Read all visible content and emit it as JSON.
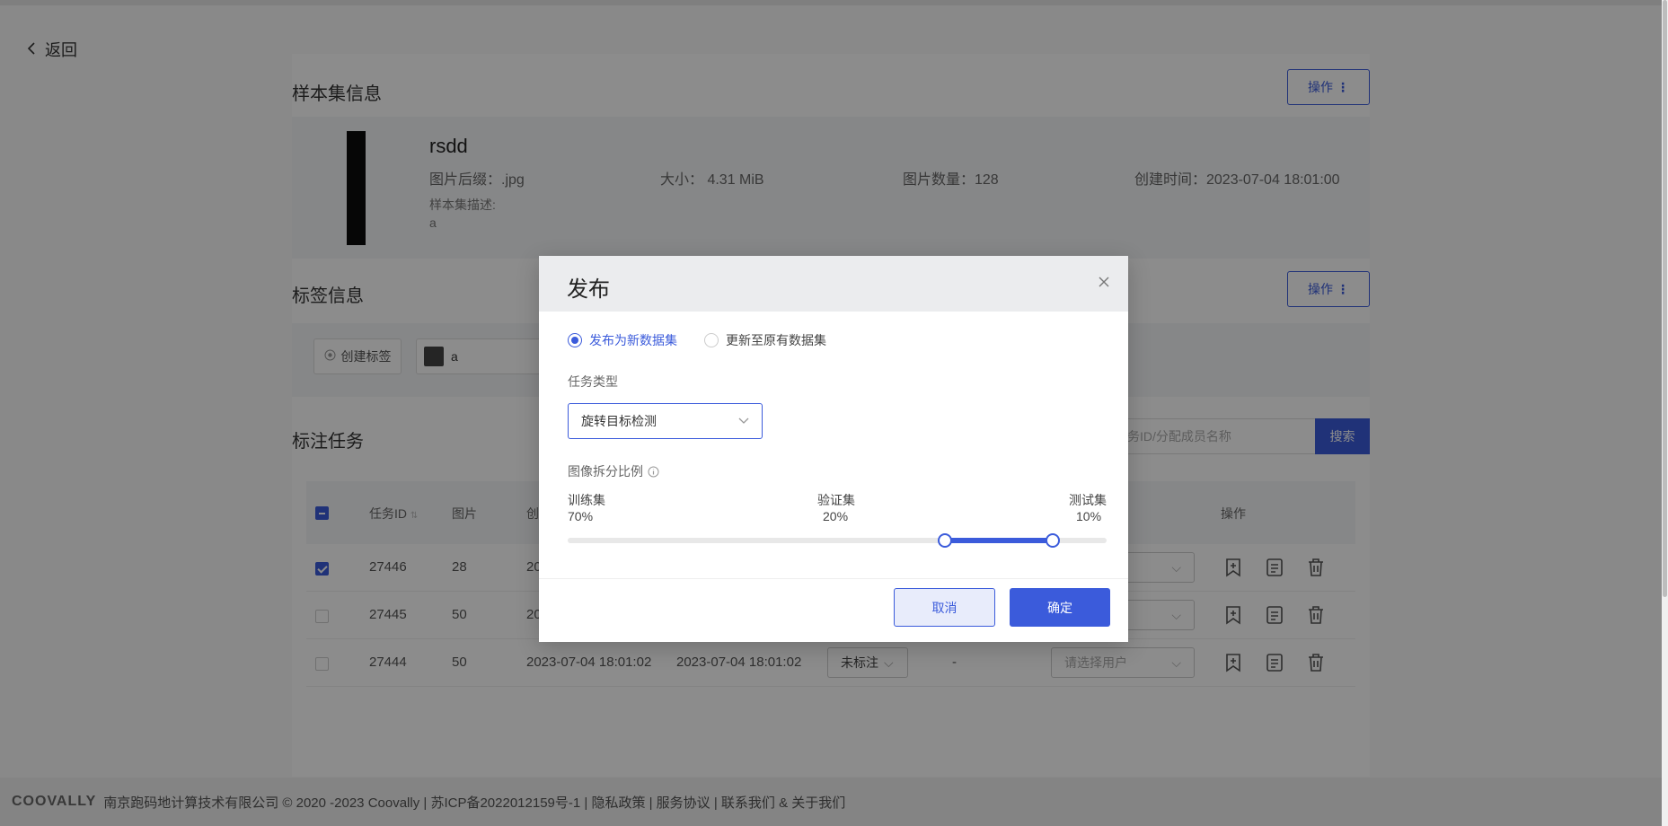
{
  "nav": {
    "back_label": "返回"
  },
  "dataset_section": {
    "title": "样本集信息",
    "op_button": "操作",
    "name": "rsdd",
    "suffix": "图片后缀：.jpg",
    "size": "大小：  4.31 MiB",
    "image_count": "图片数量：128",
    "created": "创建时间：2023-07-04 18:01:00",
    "desc_label": "样本集描述:",
    "desc_value": "a"
  },
  "label_section": {
    "title": "标签信息",
    "op_button": "操作",
    "create_label": "创建标签",
    "labels": [
      {
        "name": "a",
        "color": "#444444"
      }
    ]
  },
  "task_section": {
    "title": "标注任务",
    "search_placeholder": "务ID/分配成员名称",
    "search_button": "搜索",
    "columns": {
      "task_id": "任务ID",
      "images": "图片",
      "created": "创",
      "actions": "操作"
    },
    "rows": [
      {
        "id": "27446",
        "images": "28",
        "created": "20",
        "checked": true
      },
      {
        "id": "27445",
        "images": "50",
        "created": "20",
        "checked": false
      },
      {
        "id": "27444",
        "images": "50",
        "created": "2023-07-04 18:01:02",
        "updated": "2023-07-04 18:01:02",
        "status": "未标注",
        "assignee": "-",
        "user_placeholder": "请选择用户",
        "checked": false
      }
    ]
  },
  "footer": {
    "logo": "COOVALLY",
    "text": "南京跑码地计算技术有限公司 © 2020 -2023 Coovally | 苏ICP备2022012159号-1 | 隐私政策 | 服务协议 | 联系我们 & 关于我们"
  },
  "modal": {
    "title": "发布",
    "radio_new": "发布为新数据集",
    "radio_update": "更新至原有数据集",
    "selected_option": "new",
    "task_type_label": "任务类型",
    "task_type_value": "旋转目标检测",
    "ratio_label": "图像拆分比例",
    "train_name": "训练集",
    "train_value": "70%",
    "val_name": "验证集",
    "val_value": "20%",
    "test_name": "测试集",
    "test_value": "10%",
    "split_fractions": {
      "train": 0.7,
      "val": 0.2,
      "test": 0.1
    },
    "cancel_label": "取消",
    "ok_label": "确定"
  },
  "colors": {
    "accent": "#3b5bdb",
    "overlay": "rgba(0,0,0,0.45)"
  }
}
